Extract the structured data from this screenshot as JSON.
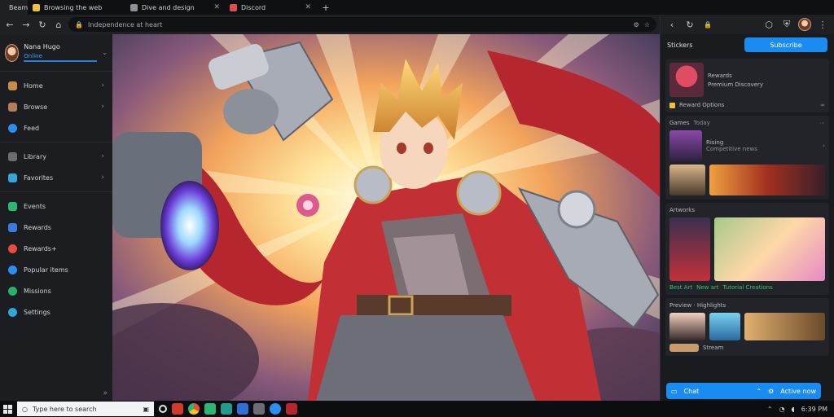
{
  "tabs": [
    {
      "label": "Beam",
      "color": "#3aa7ff"
    },
    {
      "label": "Browsing the web",
      "color": "#f0c23a"
    },
    {
      "label": "Dive and design",
      "color": "#8f8f96"
    },
    {
      "label": "Discord",
      "color": "#e04d4d"
    }
  ],
  "toolbar": {
    "url": "Independence at heart"
  },
  "sidebar": {
    "profile": {
      "name": "Nana Hugo",
      "status": "Online"
    },
    "groups": [
      [
        {
          "label": "Home",
          "icon": "home-icon",
          "color": "#c98a4a",
          "chevron": true
        },
        {
          "label": "Browse",
          "icon": "browse-icon",
          "color": "#b57d5a",
          "chevron": true
        },
        {
          "label": "Feed",
          "icon": "feed-icon",
          "color": "#2c8ef0",
          "chevron": false
        }
      ],
      [
        {
          "label": "Library",
          "icon": "library-icon",
          "color": "#6b6d73",
          "chevron": true
        },
        {
          "label": "Favorites",
          "icon": "favorites-icon",
          "color": "#38a5d8",
          "chevron": true
        }
      ],
      [
        {
          "label": "Events",
          "icon": "events-icon",
          "color": "#2bb673",
          "chevron": false
        },
        {
          "label": "Rewards",
          "icon": "rewards-icon",
          "color": "#3b7be0",
          "chevron": false
        },
        {
          "label": "Rewards+",
          "icon": "rewards-plus-icon",
          "color": "#e94b3c",
          "chevron": false
        },
        {
          "label": "Popular items",
          "icon": "popular-icon",
          "color": "#2c8ef0",
          "chevron": false
        },
        {
          "label": "Missions",
          "icon": "missions-icon",
          "color": "#27b16a",
          "chevron": false
        },
        {
          "label": "Settings",
          "icon": "settings-icon",
          "color": "#2fa7d8",
          "chevron": false
        }
      ]
    ]
  },
  "panel": {
    "title": "Stickers",
    "button": "Subscribe",
    "featured": {
      "title": "Rewards",
      "subtitle": "Premium Discovery",
      "tag": "Reward Options"
    },
    "section1": {
      "title": "Games",
      "count": "Today",
      "item": "Rising",
      "item_sub": "Competitive news"
    },
    "section2": {
      "title": "Artworks",
      "labels": [
        "Best Art",
        "New art",
        "Tutorial Creations"
      ]
    },
    "section3": {
      "title": "Preview · Highlights",
      "item": "Stream"
    },
    "bottom": {
      "label": "Chat",
      "status": "Active now"
    }
  },
  "taskbar": {
    "search_placeholder": "Type here to search",
    "time": "6:39 PM"
  }
}
